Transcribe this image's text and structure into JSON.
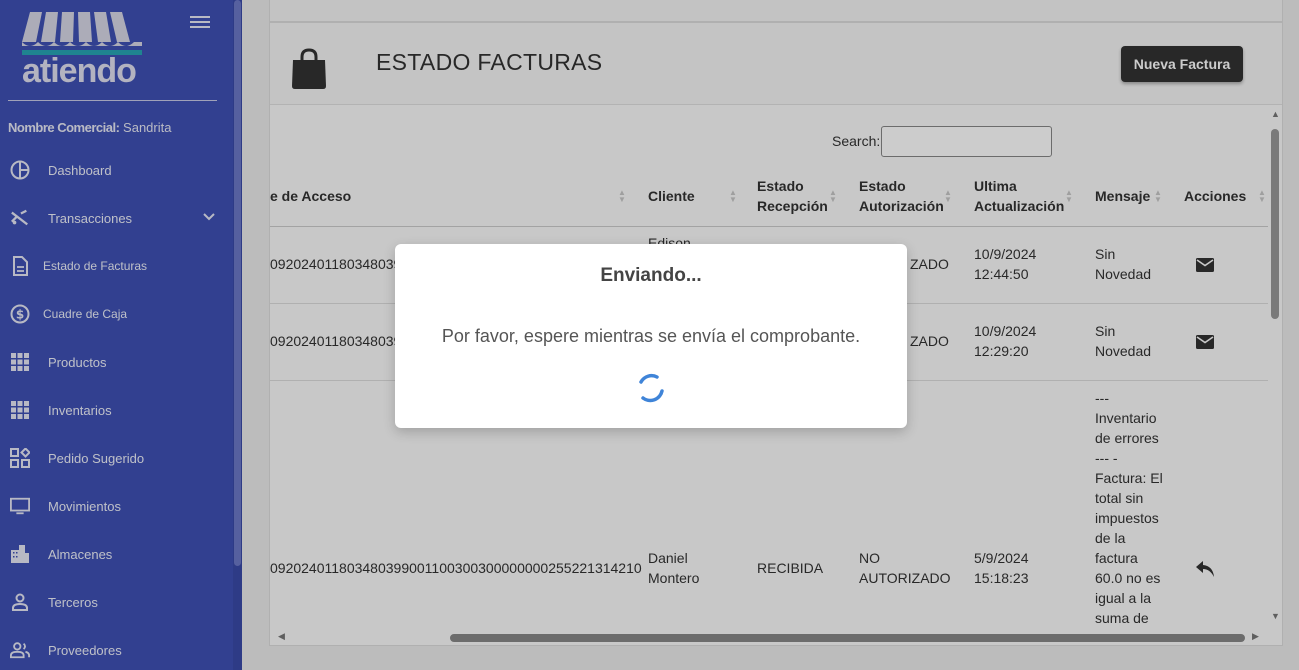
{
  "sidebar": {
    "logo_text": "atiendo",
    "commercial_label": "Nombre Comercial:",
    "commercial_value": "Sandrita",
    "items": [
      {
        "label": "Dashboard",
        "icon": "pie-chart-icon"
      },
      {
        "label": "Transacciones",
        "icon": "tools-icon"
      },
      {
        "label": "Estado de Facturas",
        "icon": "document-icon"
      },
      {
        "label": "Cuadre de Caja",
        "icon": "dollar-circle-icon"
      },
      {
        "label": "Productos",
        "icon": "grid-icon"
      },
      {
        "label": "Inventarios",
        "icon": "grid-icon"
      },
      {
        "label": "Pedido Sugerido",
        "icon": "widgets-icon"
      },
      {
        "label": "Movimientos",
        "icon": "monitor-icon"
      },
      {
        "label": "Almacenes",
        "icon": "buildings-icon"
      },
      {
        "label": "Terceros",
        "icon": "person-icon"
      },
      {
        "label": "Proveedores",
        "icon": "people-icon"
      }
    ]
  },
  "main": {
    "title": "ESTADO FACTURAS",
    "new_button": "Nueva Factura",
    "search_label": "Search:",
    "search_value": ""
  },
  "table": {
    "headers": {
      "clave": "e de Acceso",
      "cliente": "Cliente",
      "recepcion_1": "Estado",
      "recepcion_2": "Recepción",
      "autorizacion_1": "Estado",
      "autorizacion_2": "Autorización",
      "actualizacion_1": "Ultima",
      "actualizacion_2": "Actualización",
      "mensaje": "Mensaje",
      "acciones": "Acciones"
    },
    "rows": [
      {
        "clave": "0920240118034803990",
        "cliente": "Edison",
        "autorizacion": "ZADO",
        "fecha": "10/9/2024",
        "hora": "12:44:50",
        "mensaje": "Sin Novedad",
        "accion": "envelope-icon"
      },
      {
        "clave": "0920240118034803990",
        "cliente": "",
        "autorizacion": "ZADO",
        "fecha": "10/9/2024",
        "hora": "12:29:20",
        "mensaje": "Sin Novedad",
        "accion": "envelope-icon"
      },
      {
        "clave": "092024011803480399001100300300000000255221314210",
        "cliente": "Daniel Montero",
        "recepcion": "RECIBIDA",
        "autorizacion_1": "NO",
        "autorizacion_2": "AUTORIZADO",
        "fecha": "5/9/2024",
        "hora": "15:18:23",
        "mensaje": "--- Inventario de errores --- - Factura: El total sin impuestos de la factura 60.0 no es igual a la suma de",
        "accion": "reply-icon"
      }
    ]
  },
  "modal": {
    "title": "Enviando...",
    "message": "Por favor, espere mientras se envía el comprobante."
  }
}
